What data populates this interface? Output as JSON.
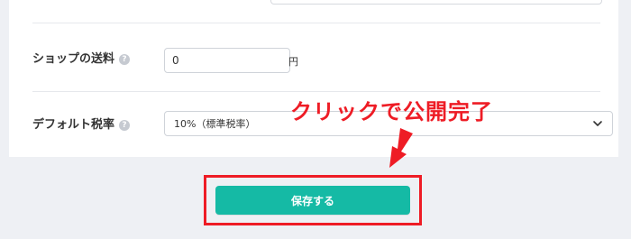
{
  "form": {
    "shipping": {
      "label": "ショップの送料",
      "value": "0",
      "unit": "円"
    },
    "tax": {
      "label": "デフォルト税率",
      "selected": "10%（標準税率）"
    },
    "help_glyph": "?",
    "save_label": "保存する"
  },
  "annotation": {
    "text": "クリックで公開完了",
    "color": "#ee1c25"
  },
  "colors": {
    "accent": "#15baa5",
    "highlight": "#ee1c25",
    "background": "#eef0f4"
  },
  "icons": [
    "help-icon",
    "chevron-down-icon",
    "arrow-down-icon"
  ]
}
